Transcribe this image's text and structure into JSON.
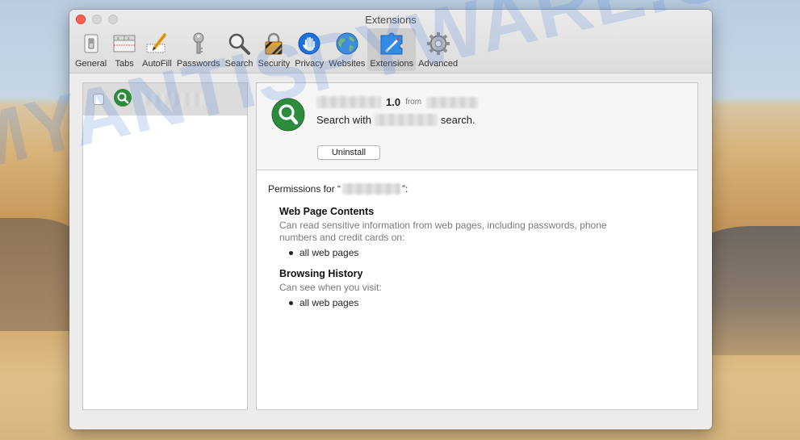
{
  "window": {
    "title": "Extensions"
  },
  "toolbar": {
    "tabs": [
      {
        "id": "general",
        "label": "General",
        "icon": "switch-icon"
      },
      {
        "id": "tabs",
        "label": "Tabs",
        "icon": "tabs-window-icon"
      },
      {
        "id": "autofill",
        "label": "AutoFill",
        "icon": "pencil-form-icon"
      },
      {
        "id": "passwords",
        "label": "Passwords",
        "icon": "key-icon"
      },
      {
        "id": "search",
        "label": "Search",
        "icon": "magnifier-icon"
      },
      {
        "id": "security",
        "label": "Security",
        "icon": "padlock-icon"
      },
      {
        "id": "privacy",
        "label": "Privacy",
        "icon": "hand-icon"
      },
      {
        "id": "websites",
        "label": "Websites",
        "icon": "globe-icon"
      },
      {
        "id": "extensions",
        "label": "Extensions",
        "icon": "puzzle-compass-icon",
        "active": true
      },
      {
        "id": "advanced",
        "label": "Advanced",
        "icon": "gear-icon"
      }
    ]
  },
  "extension_list": {
    "items": [
      {
        "name_redacted": true,
        "enabled": false,
        "icon": "search-extension-icon",
        "selected": true
      }
    ]
  },
  "detail": {
    "version": "1.0",
    "from_label": "from",
    "desc_prefix": "Search with",
    "desc_suffix": "search.",
    "uninstall_label": "Uninstall",
    "permissions_prefix": "Permissions for “",
    "permissions_suffix": "”:",
    "permissions": [
      {
        "title": "Web Page Contents",
        "description": "Can read sensitive information from web pages, including passwords, phone numbers and credit cards on:",
        "items": [
          "all web pages"
        ]
      },
      {
        "title": "Browsing History",
        "description": "Can see when you visit:",
        "items": [
          "all web pages"
        ]
      }
    ]
  },
  "watermark": "MYANTISPYWARE.COM",
  "colors": {
    "accent_active_tab": "#cdcdcd",
    "close_button": "#fc5f57",
    "extension_icon_green": "#2e8b3e",
    "privacy_blue": "#1a6fe0"
  }
}
